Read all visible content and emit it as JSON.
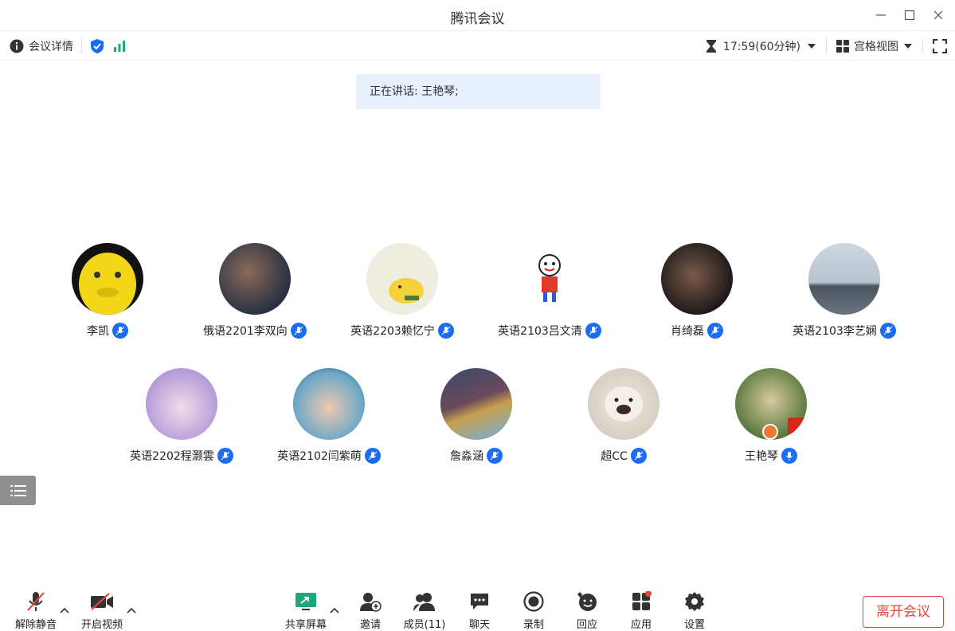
{
  "window": {
    "title": "腾讯会议"
  },
  "toolbar": {
    "details_label": "会议详情",
    "timer": "17:59(60分钟)",
    "view_label": "宫格视图"
  },
  "speaking": {
    "text": "正在讲话: 王艳琴;"
  },
  "participants": [
    {
      "name": "李凯"
    },
    {
      "name": "俄语2201李双向"
    },
    {
      "name": "英语2203赖忆宁"
    },
    {
      "name": "英语2103吕文清"
    },
    {
      "name": "肖绮磊"
    },
    {
      "name": "英语2103李艺娴"
    },
    {
      "name": "英语2202程灏雲"
    },
    {
      "name": "英语2102闫紫萌"
    },
    {
      "name": "詹淼涵"
    },
    {
      "name": "超CC"
    },
    {
      "name": "王艳琴"
    }
  ],
  "bottom": {
    "unmute": "解除静音",
    "video": "开启视频",
    "share": "共享屏幕",
    "invite": "邀请",
    "members": "成员(11)",
    "chat": "聊天",
    "record": "录制",
    "react": "回应",
    "apps": "应用",
    "settings": "设置",
    "leave": "离开会议"
  },
  "colors": {
    "accent": "#1a6cf5",
    "leave": "#e24b3c",
    "share": "#1aaa7a"
  }
}
